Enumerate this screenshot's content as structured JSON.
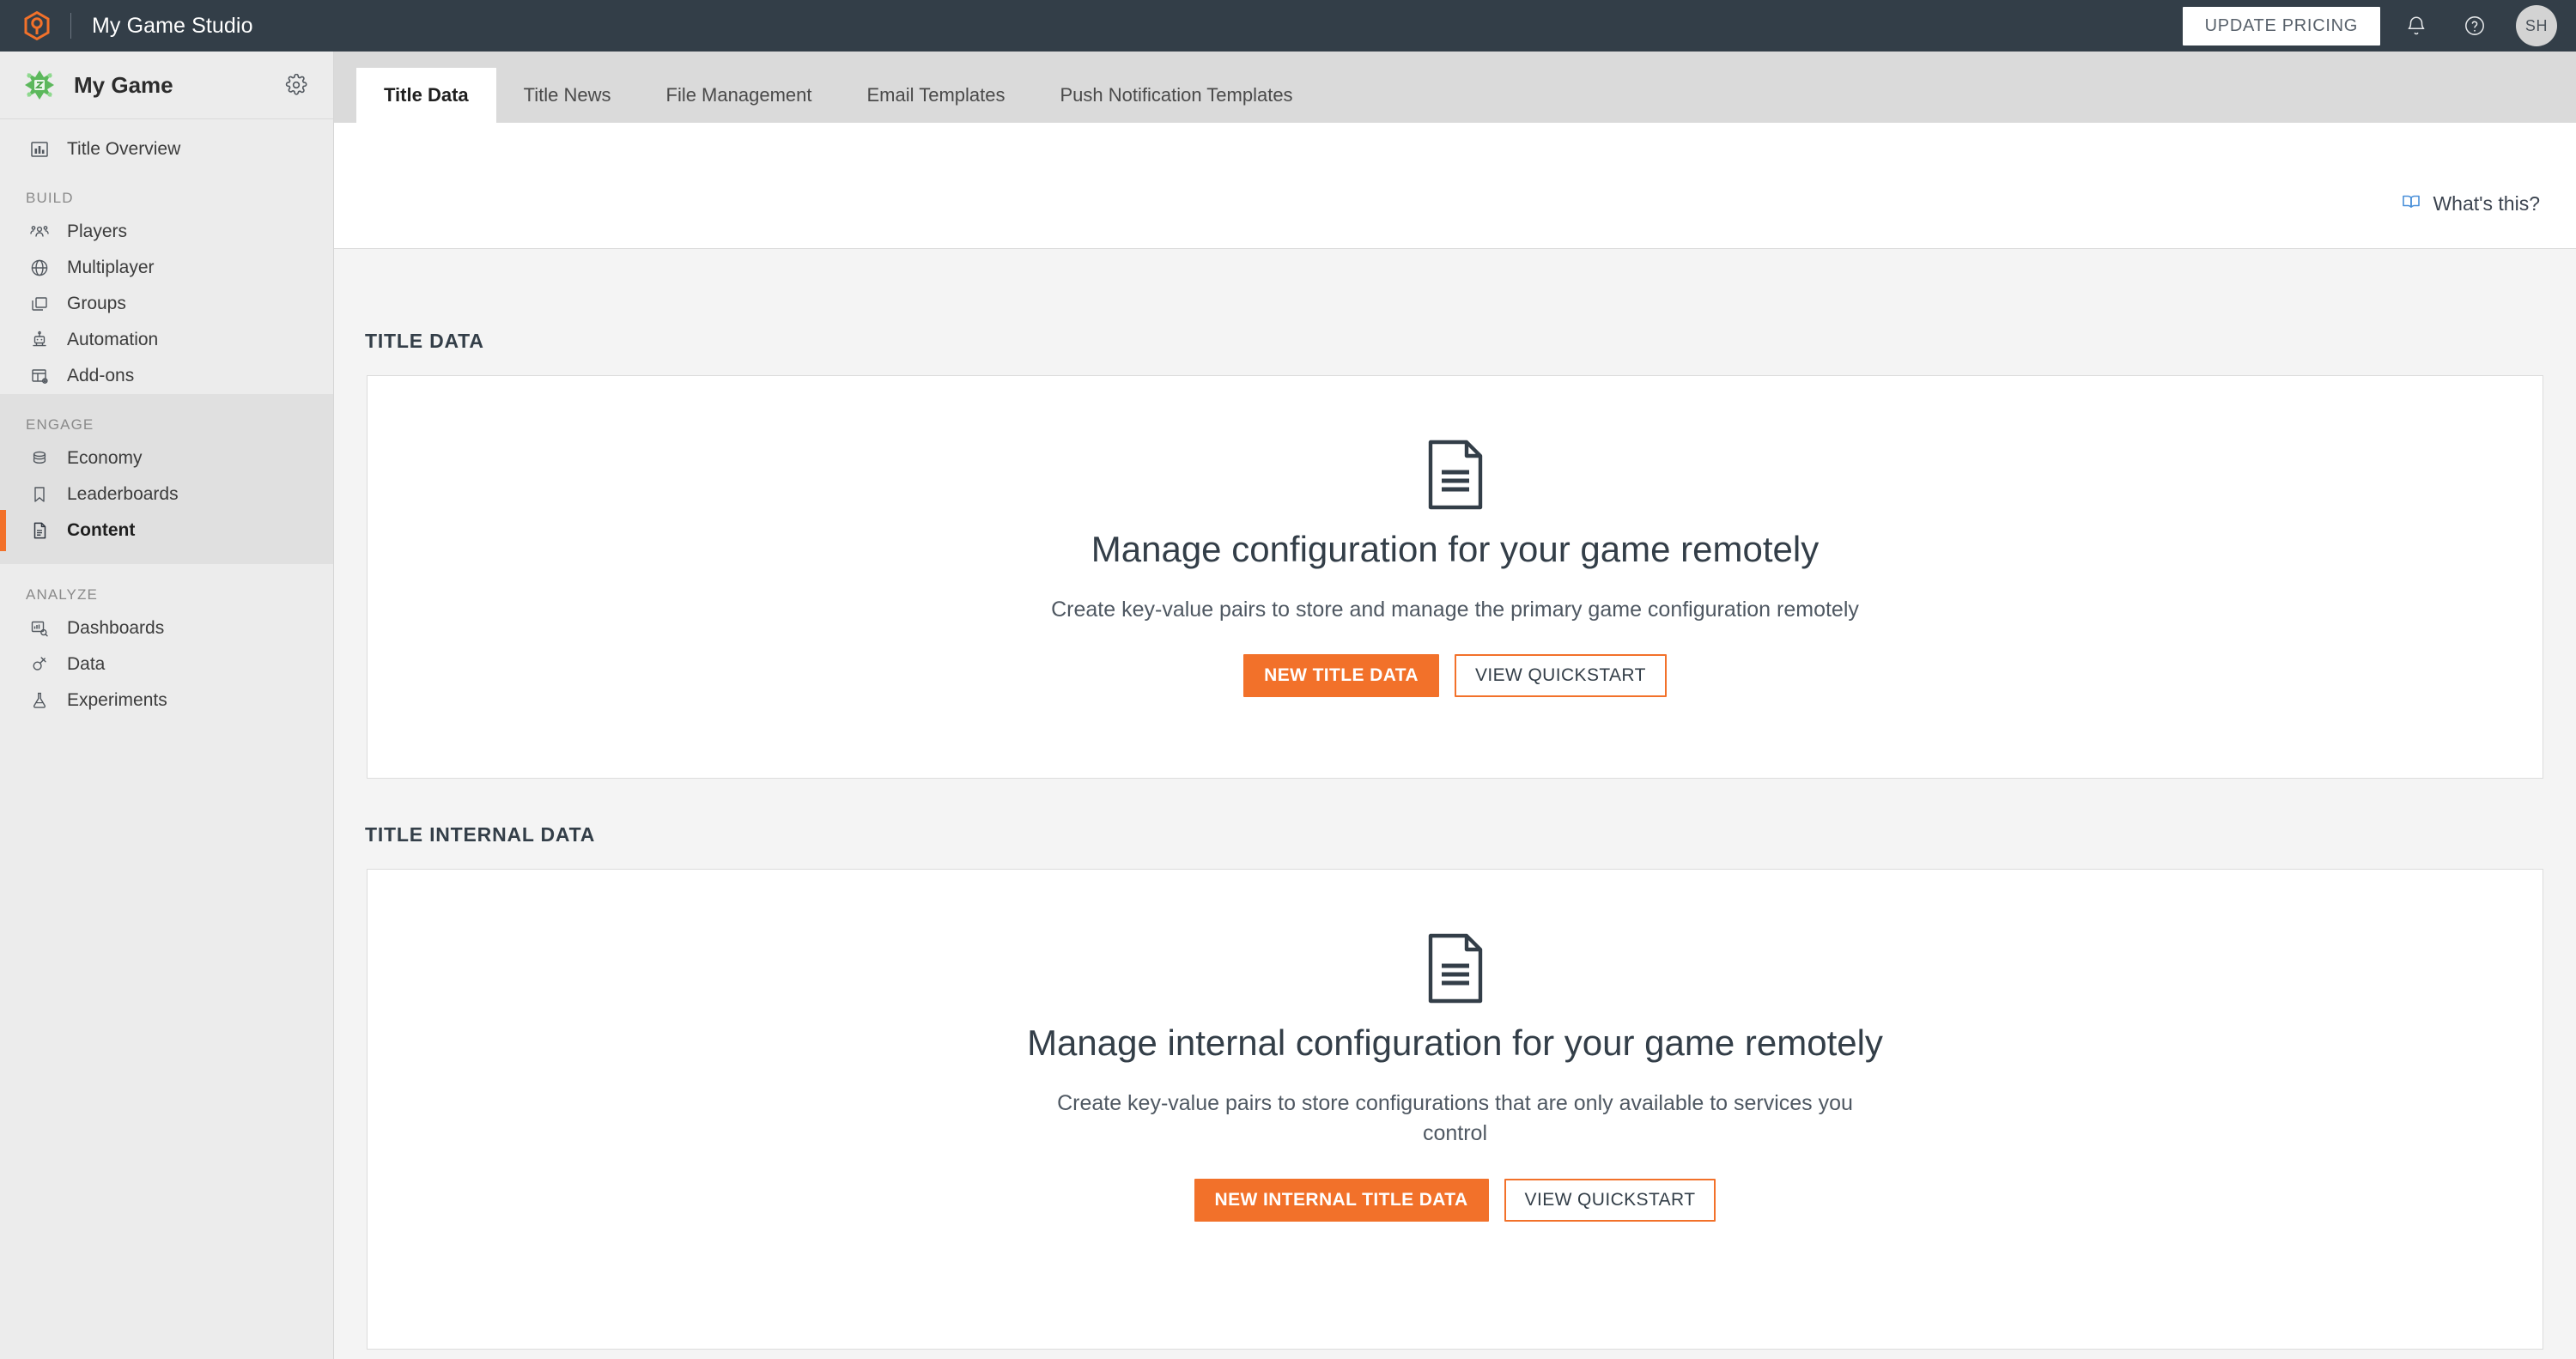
{
  "header": {
    "logo_icon": "playfab-hexagon-logo",
    "studio_name": "My Game Studio",
    "update_pricing_label": "UPDATE PRICING",
    "notification_icon": "bell-icon",
    "help_icon": "question-circle-icon",
    "avatar_initials": "SH"
  },
  "sidebar": {
    "game_name": "My Game",
    "game_icon": "green-starburst-game-icon",
    "settings_icon": "gear-icon",
    "top_items": [
      {
        "label": "Title Overview",
        "icon": "bar-chart-icon"
      }
    ],
    "sections": [
      {
        "label": "BUILD",
        "items": [
          {
            "label": "Players",
            "icon": "people-icon"
          },
          {
            "label": "Multiplayer",
            "icon": "globe-icon"
          },
          {
            "label": "Groups",
            "icon": "stacked-squares-icon"
          },
          {
            "label": "Automation",
            "icon": "robot-icon"
          },
          {
            "label": "Add-ons",
            "icon": "grid-gear-icon"
          }
        ]
      },
      {
        "label": "ENGAGE",
        "items": [
          {
            "label": "Economy",
            "icon": "coins-stack-icon"
          },
          {
            "label": "Leaderboards",
            "icon": "bookmark-icon"
          },
          {
            "label": "Content",
            "icon": "document-icon",
            "active": true
          }
        ]
      },
      {
        "label": "ANALYZE",
        "items": [
          {
            "label": "Dashboards",
            "icon": "chart-search-icon"
          },
          {
            "label": "Data",
            "icon": "plug-search-icon"
          },
          {
            "label": "Experiments",
            "icon": "flask-icon"
          }
        ]
      }
    ]
  },
  "tabs": [
    {
      "label": "Title Data",
      "active": true
    },
    {
      "label": "Title News",
      "active": false
    },
    {
      "label": "File Management",
      "active": false
    },
    {
      "label": "Email Templates",
      "active": false
    },
    {
      "label": "Push Notification Templates",
      "active": false
    }
  ],
  "subheader": {
    "whats_this_label": "What's this?",
    "whats_this_icon": "open-book-icon"
  },
  "main": {
    "sections": [
      {
        "title": "TITLE DATA",
        "card": {
          "icon": "document-icon",
          "heading": "Manage configuration for your game remotely",
          "description": "Create key-value pairs to store and manage the primary game configuration remotely",
          "primary_button": "NEW TITLE DATA",
          "secondary_button": "VIEW QUICKSTART"
        }
      },
      {
        "title": "TITLE INTERNAL DATA",
        "card": {
          "icon": "document-icon",
          "heading": "Manage internal configuration for your game remotely",
          "description": "Create key-value pairs to store configurations that are only available to services you control",
          "primary_button": "NEW INTERNAL TITLE DATA",
          "secondary_button": "VIEW QUICKSTART"
        }
      }
    ]
  },
  "colors": {
    "header_bg": "#333e48",
    "accent_orange": "#f2712a",
    "sidebar_bg": "#ececec",
    "sidebar_group_active_bg": "#e0e0e0",
    "content_bg": "#f4f4f4",
    "tabbar_bg": "#dadada",
    "link_blue": "#4a90d9"
  }
}
